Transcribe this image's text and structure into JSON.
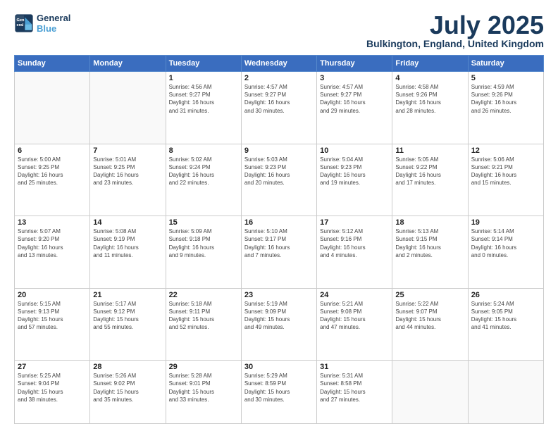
{
  "logo": {
    "line1": "General",
    "line2": "Blue"
  },
  "title": "July 2025",
  "subtitle": "Bulkington, England, United Kingdom",
  "days_of_week": [
    "Sunday",
    "Monday",
    "Tuesday",
    "Wednesday",
    "Thursday",
    "Friday",
    "Saturday"
  ],
  "weeks": [
    [
      {
        "day": "",
        "info": ""
      },
      {
        "day": "",
        "info": ""
      },
      {
        "day": "1",
        "info": "Sunrise: 4:56 AM\nSunset: 9:27 PM\nDaylight: 16 hours\nand 31 minutes."
      },
      {
        "day": "2",
        "info": "Sunrise: 4:57 AM\nSunset: 9:27 PM\nDaylight: 16 hours\nand 30 minutes."
      },
      {
        "day": "3",
        "info": "Sunrise: 4:57 AM\nSunset: 9:27 PM\nDaylight: 16 hours\nand 29 minutes."
      },
      {
        "day": "4",
        "info": "Sunrise: 4:58 AM\nSunset: 9:26 PM\nDaylight: 16 hours\nand 28 minutes."
      },
      {
        "day": "5",
        "info": "Sunrise: 4:59 AM\nSunset: 9:26 PM\nDaylight: 16 hours\nand 26 minutes."
      }
    ],
    [
      {
        "day": "6",
        "info": "Sunrise: 5:00 AM\nSunset: 9:25 PM\nDaylight: 16 hours\nand 25 minutes."
      },
      {
        "day": "7",
        "info": "Sunrise: 5:01 AM\nSunset: 9:25 PM\nDaylight: 16 hours\nand 23 minutes."
      },
      {
        "day": "8",
        "info": "Sunrise: 5:02 AM\nSunset: 9:24 PM\nDaylight: 16 hours\nand 22 minutes."
      },
      {
        "day": "9",
        "info": "Sunrise: 5:03 AM\nSunset: 9:23 PM\nDaylight: 16 hours\nand 20 minutes."
      },
      {
        "day": "10",
        "info": "Sunrise: 5:04 AM\nSunset: 9:23 PM\nDaylight: 16 hours\nand 19 minutes."
      },
      {
        "day": "11",
        "info": "Sunrise: 5:05 AM\nSunset: 9:22 PM\nDaylight: 16 hours\nand 17 minutes."
      },
      {
        "day": "12",
        "info": "Sunrise: 5:06 AM\nSunset: 9:21 PM\nDaylight: 16 hours\nand 15 minutes."
      }
    ],
    [
      {
        "day": "13",
        "info": "Sunrise: 5:07 AM\nSunset: 9:20 PM\nDaylight: 16 hours\nand 13 minutes."
      },
      {
        "day": "14",
        "info": "Sunrise: 5:08 AM\nSunset: 9:19 PM\nDaylight: 16 hours\nand 11 minutes."
      },
      {
        "day": "15",
        "info": "Sunrise: 5:09 AM\nSunset: 9:18 PM\nDaylight: 16 hours\nand 9 minutes."
      },
      {
        "day": "16",
        "info": "Sunrise: 5:10 AM\nSunset: 9:17 PM\nDaylight: 16 hours\nand 7 minutes."
      },
      {
        "day": "17",
        "info": "Sunrise: 5:12 AM\nSunset: 9:16 PM\nDaylight: 16 hours\nand 4 minutes."
      },
      {
        "day": "18",
        "info": "Sunrise: 5:13 AM\nSunset: 9:15 PM\nDaylight: 16 hours\nand 2 minutes."
      },
      {
        "day": "19",
        "info": "Sunrise: 5:14 AM\nSunset: 9:14 PM\nDaylight: 16 hours\nand 0 minutes."
      }
    ],
    [
      {
        "day": "20",
        "info": "Sunrise: 5:15 AM\nSunset: 9:13 PM\nDaylight: 15 hours\nand 57 minutes."
      },
      {
        "day": "21",
        "info": "Sunrise: 5:17 AM\nSunset: 9:12 PM\nDaylight: 15 hours\nand 55 minutes."
      },
      {
        "day": "22",
        "info": "Sunrise: 5:18 AM\nSunset: 9:11 PM\nDaylight: 15 hours\nand 52 minutes."
      },
      {
        "day": "23",
        "info": "Sunrise: 5:19 AM\nSunset: 9:09 PM\nDaylight: 15 hours\nand 49 minutes."
      },
      {
        "day": "24",
        "info": "Sunrise: 5:21 AM\nSunset: 9:08 PM\nDaylight: 15 hours\nand 47 minutes."
      },
      {
        "day": "25",
        "info": "Sunrise: 5:22 AM\nSunset: 9:07 PM\nDaylight: 15 hours\nand 44 minutes."
      },
      {
        "day": "26",
        "info": "Sunrise: 5:24 AM\nSunset: 9:05 PM\nDaylight: 15 hours\nand 41 minutes."
      }
    ],
    [
      {
        "day": "27",
        "info": "Sunrise: 5:25 AM\nSunset: 9:04 PM\nDaylight: 15 hours\nand 38 minutes."
      },
      {
        "day": "28",
        "info": "Sunrise: 5:26 AM\nSunset: 9:02 PM\nDaylight: 15 hours\nand 35 minutes."
      },
      {
        "day": "29",
        "info": "Sunrise: 5:28 AM\nSunset: 9:01 PM\nDaylight: 15 hours\nand 33 minutes."
      },
      {
        "day": "30",
        "info": "Sunrise: 5:29 AM\nSunset: 8:59 PM\nDaylight: 15 hours\nand 30 minutes."
      },
      {
        "day": "31",
        "info": "Sunrise: 5:31 AM\nSunset: 8:58 PM\nDaylight: 15 hours\nand 27 minutes."
      },
      {
        "day": "",
        "info": ""
      },
      {
        "day": "",
        "info": ""
      }
    ]
  ]
}
